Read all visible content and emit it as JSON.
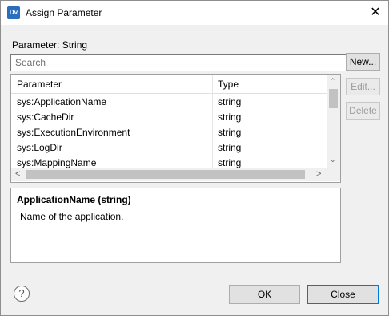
{
  "window": {
    "title": "Assign Parameter",
    "app_icon_text": "Dv",
    "close_glyph": "✕"
  },
  "parameter_label": "Parameter: String",
  "search": {
    "placeholder": "Search",
    "value": ""
  },
  "buttons": {
    "new": "New...",
    "edit": "Edit...",
    "delete": "Delete",
    "ok": "OK",
    "close": "Close"
  },
  "table": {
    "headers": [
      "Parameter",
      "Type"
    ],
    "rows": [
      {
        "name": "sys:ApplicationName",
        "type": "string"
      },
      {
        "name": "sys:CacheDir",
        "type": "string"
      },
      {
        "name": "sys:ExecutionEnvironment",
        "type": "string"
      },
      {
        "name": "sys:LogDir",
        "type": "string"
      },
      {
        "name": "sys:MappingName",
        "type": "string"
      }
    ]
  },
  "description": {
    "title": "ApplicationName (string)",
    "body": "Name of the application."
  },
  "help_glyph": "?",
  "icons": {
    "scroll_up": "⌃",
    "scroll_down": "⌄",
    "scroll_left": "<",
    "scroll_right": ">"
  }
}
